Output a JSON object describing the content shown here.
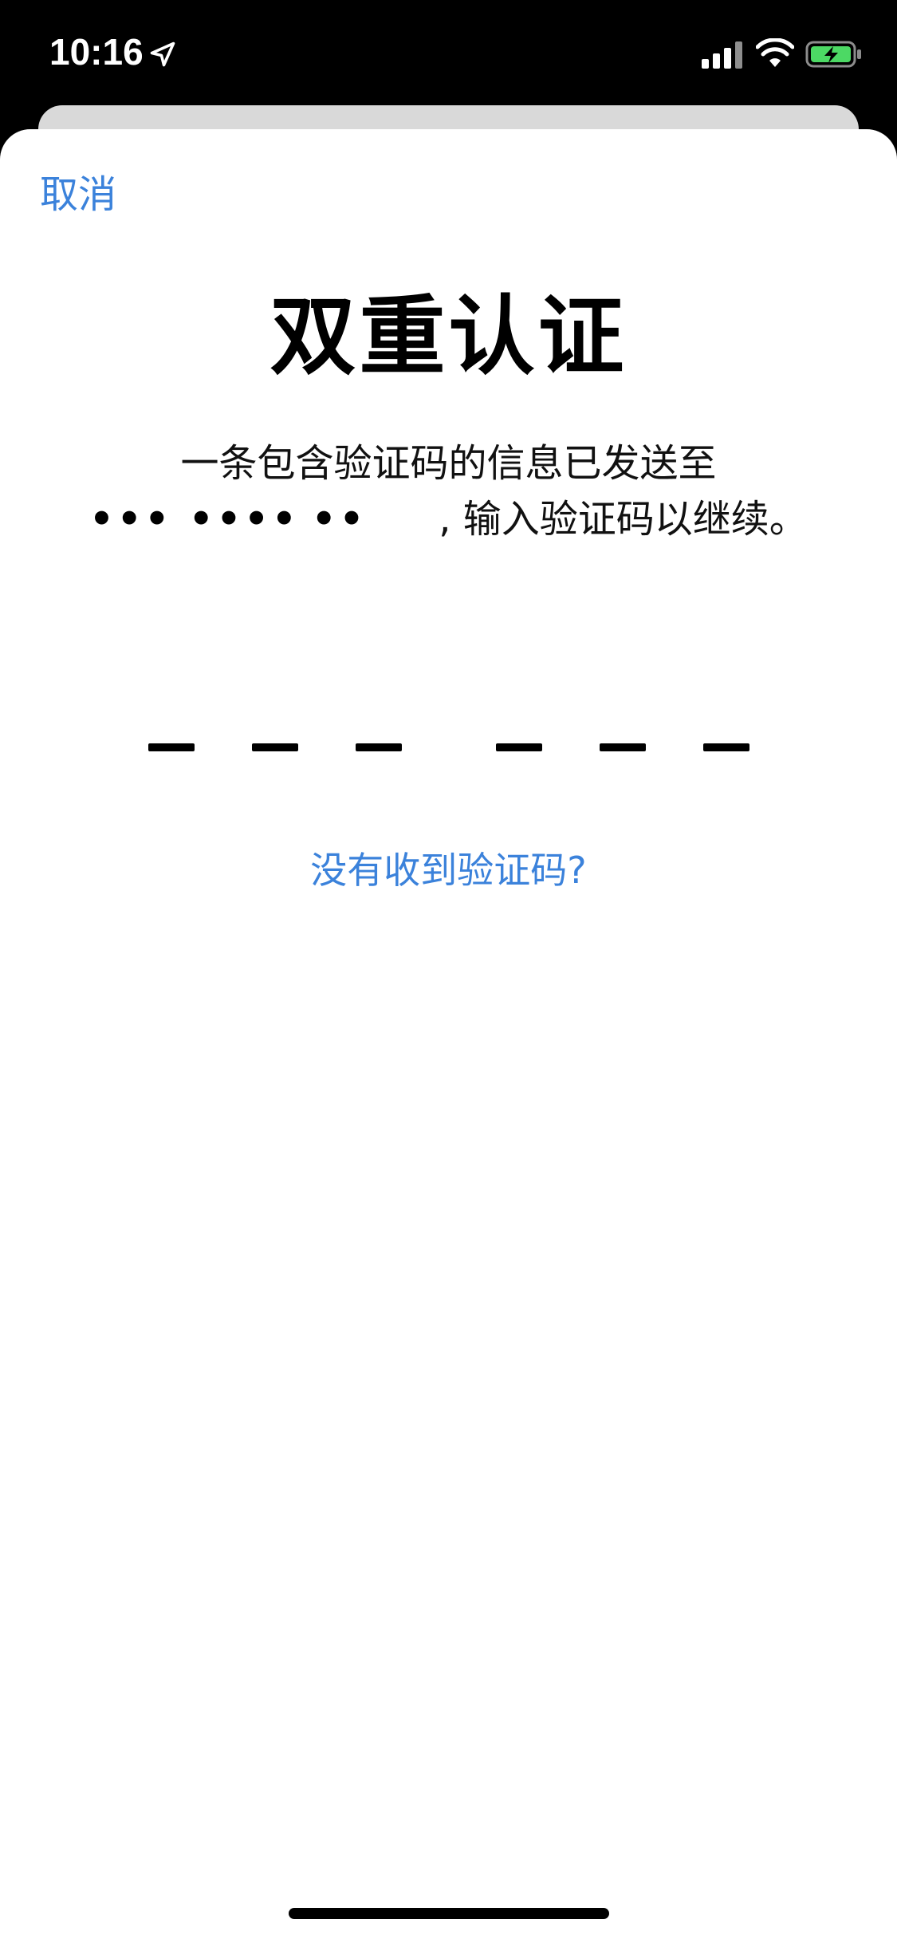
{
  "status_bar": {
    "time": "10:16",
    "icons": [
      "location-arrow-icon",
      "cellular-signal-icon",
      "wifi-icon",
      "battery-charging-icon"
    ],
    "battery_color": "#4cd964"
  },
  "sheet": {
    "cancel_label": "取消",
    "title": "双重认证",
    "description_line1": "一条包含验证码的信息已发送至",
    "masked_phone_part1": "••• ••••",
    "masked_phone_part2": "••",
    "masked_phone_comma": ",",
    "description_line2": "输入验证码以继续。",
    "code_slots": [
      "",
      "",
      "",
      "",
      "",
      ""
    ],
    "resend_label": "没有收到验证码?"
  },
  "colors": {
    "accent": "#3b82db",
    "text": "#000000",
    "background": "#ffffff"
  }
}
